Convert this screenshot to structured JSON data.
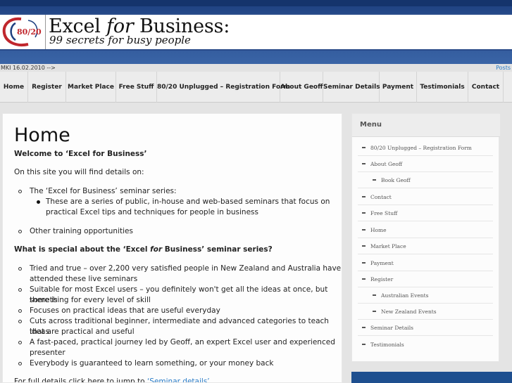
{
  "header": {
    "title_part1": "Excel ",
    "title_italic": "for",
    "title_part2": " Business:",
    "tagline": "99 secrets for busy people",
    "logo_text": "80/20"
  },
  "strip": {
    "left_text": "MKI 16.02.2010 -->",
    "right_text": "Posts"
  },
  "nav": {
    "items": [
      {
        "label": "Home"
      },
      {
        "label": "Register"
      },
      {
        "label": "Market Place"
      },
      {
        "label": "Free Stuff"
      },
      {
        "label": "80/20 Unplugged – Registration Form"
      },
      {
        "label": "About Geoff"
      },
      {
        "label": "Seminar Details"
      },
      {
        "label": "Payment"
      },
      {
        "label": "Testimonials"
      },
      {
        "label": "Contact"
      }
    ]
  },
  "main": {
    "title": "Home",
    "welcome": "Welcome to ‘Excel for Business’",
    "intro": "On this site you will find details on:",
    "list1": {
      "item1": "The ‘Excel for Business’ seminar series:",
      "sub1_line1": "These are a series of public, in-house and web-based seminars that focus on",
      "sub1_line2": "practical Excel tips and techniques for people in business",
      "item2": "Other training opportunities"
    },
    "question_part1": "What is special about the ‘Excel ",
    "question_italic": "for",
    "question_part2": " Business’ seminar series?",
    "list2": [
      {
        "line1": "Tried and true – over 2,200 very satisfied people in New Zealand and Australia have",
        "line2": "attended these live seminars"
      },
      {
        "line1": "Suitable for most Excel users – you definitely won't get all the ideas at once, but there is",
        "line2": "something for every level of skill"
      },
      {
        "line1": "Focuses on practical ideas that are useful everyday",
        "line2": ""
      },
      {
        "line1": "Cuts across traditional beginner, intermediate and advanced categories to teach ideas",
        "line2": "that are practical and useful"
      },
      {
        "line1": "A fast-paced, practical journey led by Geoff, an expert Excel user and experienced",
        "line2": "presenter"
      },
      {
        "line1": "Everybody is guaranteed to learn something, or your money back",
        "line2": ""
      }
    ],
    "footer_text": "For full details click here to jump to ",
    "footer_link": "‘Seminar details’"
  },
  "sidebar": {
    "title": "Menu",
    "items": [
      {
        "label": "80/20 Unplugged – Registration Form"
      },
      {
        "label": "About Geoff"
      },
      {
        "label": "Book Geoff"
      },
      {
        "label": "Contact"
      },
      {
        "label": "Free Stuff"
      },
      {
        "label": "Home"
      },
      {
        "label": "Market Place"
      },
      {
        "label": "Payment"
      },
      {
        "label": "Register"
      },
      {
        "label": "Australian Events"
      },
      {
        "label": "New Zealand Events"
      },
      {
        "label": "Seminar Details"
      },
      {
        "label": "Testimonials"
      }
    ]
  },
  "colors": {
    "header_blue": "#2d5596",
    "link_blue": "#2a7cc7",
    "logo_red": "#c0272d"
  }
}
